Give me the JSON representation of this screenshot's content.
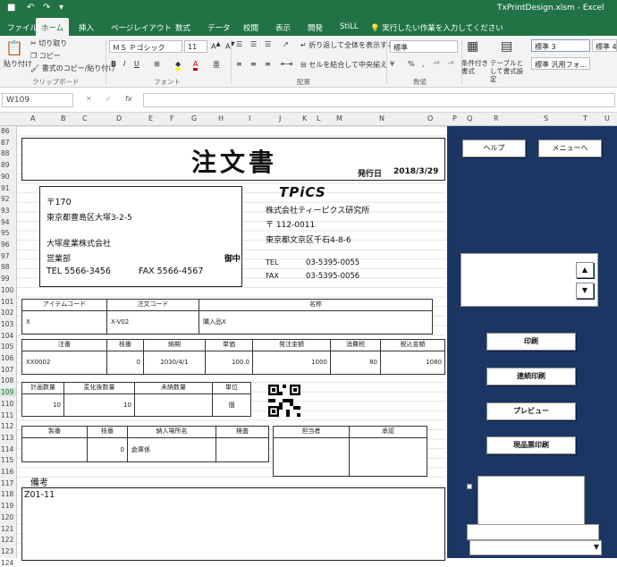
{
  "window": {
    "title": "TxPrintDesign.xlsm - Excel"
  },
  "tabs": [
    {
      "label": "ファイル"
    },
    {
      "label": "ホーム"
    },
    {
      "label": "挿入"
    },
    {
      "label": "ページレイアウト"
    },
    {
      "label": "数式"
    },
    {
      "label": "データ"
    },
    {
      "label": "校閲"
    },
    {
      "label": "表示"
    },
    {
      "label": "開発"
    },
    {
      "label": "StiLL"
    }
  ],
  "tellme": "実行したい作業を入力してください",
  "ribbon": {
    "paste": "貼り付け",
    "cut": "切り取り",
    "copy": "コピー",
    "format_painter": "書式のコピー/貼り付け",
    "clipboard": "クリップボード",
    "font_name": "ＭＳ Ｐゴシック",
    "font_size": "11",
    "font": "フォント",
    "wrap": "折り返して全体を表示する",
    "merge": "セルを結合して中央揃え",
    "alignment": "配置",
    "number_format": "標準",
    "number": "数値",
    "cond_format": "条件付き書式",
    "table_format": "テーブルとして書式設定",
    "style1": "標準 3",
    "style2": "標準 汎用フォ...",
    "style3": "標準 4"
  },
  "formula_bar": {
    "namebox": "W109",
    "fx": "fx"
  },
  "columns": [
    "A",
    "B",
    "C",
    "D",
    "E",
    "F",
    "G",
    "H",
    "I",
    "J",
    "K",
    "L",
    "M",
    "N",
    "O",
    "P",
    "Q",
    "R",
    "S",
    "T",
    "U"
  ],
  "rows": [
    "86",
    "87",
    "88",
    "89",
    "90",
    "91",
    "92",
    "93",
    "94",
    "95",
    "96",
    "97",
    "98",
    "99",
    "100",
    "101",
    "102",
    "103",
    "104",
    "105",
    "106",
    "107",
    "108",
    "109",
    "110",
    "111",
    "112",
    "113",
    "114",
    "115",
    "116",
    "117",
    "118",
    "119",
    "120",
    "121",
    "122",
    "123",
    "124"
  ],
  "form": {
    "title": "注文書",
    "issue_label": "発行日",
    "issue_date": "2018/3/29",
    "to_zip": "〒170",
    "to_addr": "東京都豊島区大塚3-2-5",
    "to_company": "大塚産業株式会社",
    "to_dept": "営業部",
    "to_honorific": "御中",
    "to_tel": "TEL  5566-3456",
    "to_fax": "FAX 5566-4567",
    "logo": "TPiCS",
    "from_company": "株式会社ティーピクス研究所",
    "from_zip": "〒 112-0011",
    "from_addr": "東京都文京区千石4-8-6",
    "tel_label": "TEL",
    "tel": "03-5395-0055",
    "fax_label": "FAX",
    "fax": "03-5395-0056",
    "t1_h": [
      "アイテムコード",
      "注文コード",
      "名称"
    ],
    "t1_v": [
      "X",
      "X-V02",
      "購入品X"
    ],
    "t2_h": [
      "注番",
      "枝番",
      "納期",
      "単価",
      "発注金額",
      "消費税",
      "税込金額"
    ],
    "t2_v": [
      "XX0002",
      "0",
      "2030/4/1",
      "100.0",
      "1000",
      "80",
      "1080"
    ],
    "t3_h": [
      "計画数量",
      "変化後数量",
      "未納数量",
      "単位"
    ],
    "t3_v": [
      "10",
      "10",
      "",
      "個"
    ],
    "t4_h": [
      "製番",
      "枝番",
      "納入場所名",
      "検査"
    ],
    "t4_v": [
      "",
      "0",
      "倉庫係",
      ""
    ],
    "t5_h": [
      "担当者",
      "承認"
    ],
    "remarks_label": "備考",
    "remarks_value": "Z01-11"
  },
  "panel": {
    "help": "ヘルプ",
    "menu": "メニューへ",
    "up": "▲",
    "down": "▼",
    "print": "印刷",
    "cont_print": "連続印刷",
    "preview": "プレビュー",
    "ticket_print": "現品票印刷",
    "dropdown_arrow": "▼"
  }
}
